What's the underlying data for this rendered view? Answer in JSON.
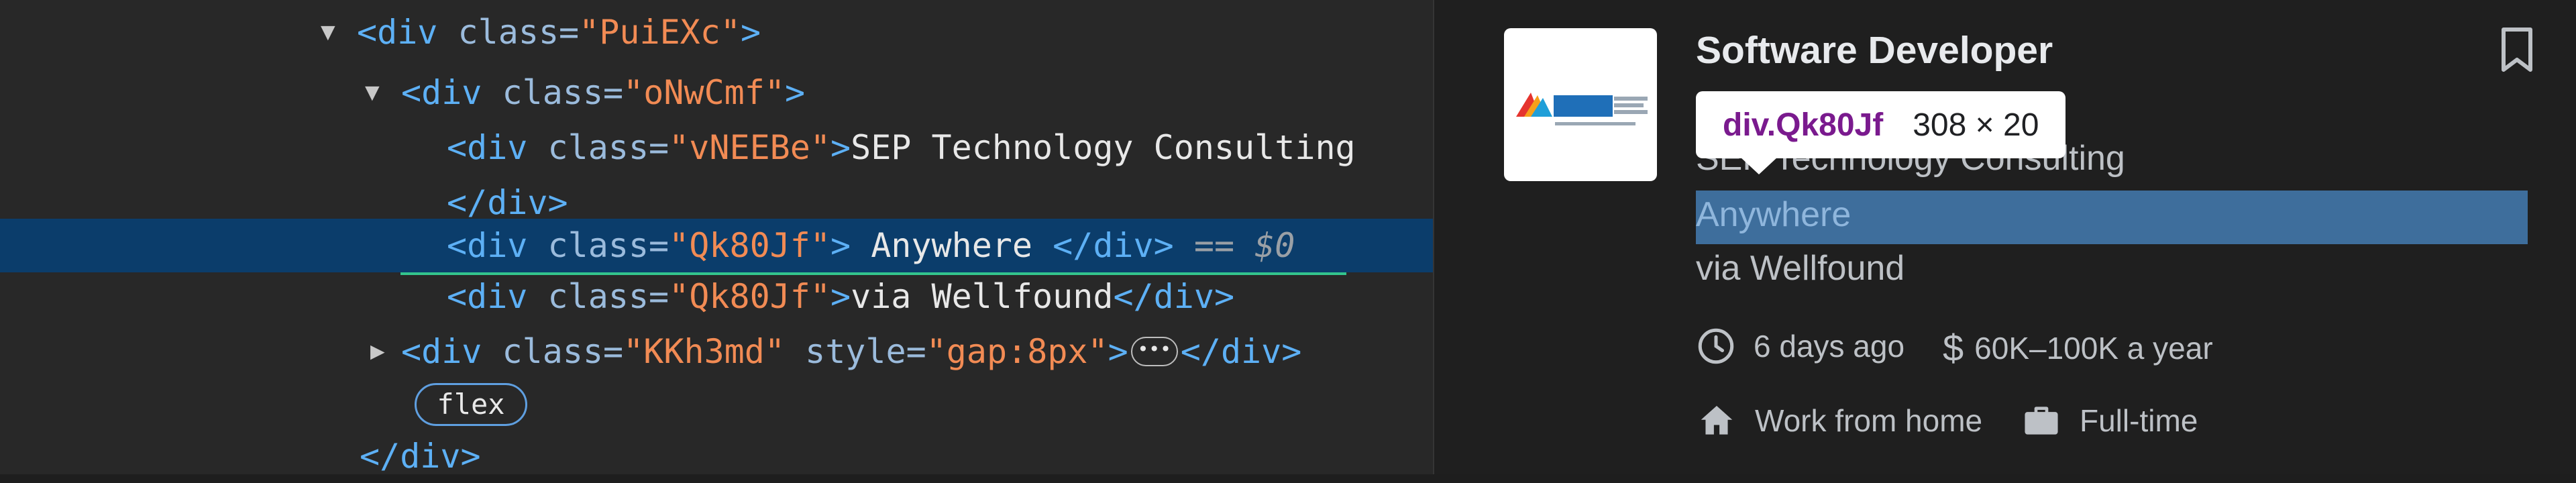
{
  "dom": {
    "line1": {
      "tag_open": "<div",
      "attr": "class=",
      "val": "\"PuiEXc\"",
      "tag_close": ">"
    },
    "line2": {
      "tag_open": "<div",
      "attr": "class=",
      "val": "\"oNwCmf\"",
      "tag_close": ">"
    },
    "line3": {
      "tag_open": "<div",
      "attr": "class=",
      "val": "\"vNEEBe\"",
      "tag_close": ">",
      "text": "SEP Technology Consulting"
    },
    "line4": {
      "close_tag": "</div>"
    },
    "line5": {
      "tag_open": "<div",
      "attr": "class=",
      "val": "\"Qk80Jf\"",
      "tag_close": ">",
      "text": " Anywhere ",
      "close_tag": "</div>",
      "marker": "==",
      "marker_var": "$0"
    },
    "line6": {
      "tag_open": "<div",
      "attr": "class=",
      "val": "\"Qk80Jf\"",
      "tag_close": ">",
      "text": "via Wellfound",
      "close_tag": "</div>"
    },
    "line7": {
      "tag_open": "<div",
      "attr": "class=",
      "val": "\"KKh3md\"",
      "attr2": " style=",
      "val2": "\"gap:8px\"",
      "tag_close": ">",
      "ellipsis": "•••",
      "close_tag": "</div>"
    },
    "flex_badge": "flex",
    "line9": {
      "close_tag": "</div>"
    }
  },
  "job": {
    "title": "Software Developer",
    "company": "SEP Technology Consulting",
    "location": "Anywhere",
    "via": "via Wellfound",
    "posted": "6 days ago",
    "salary": "60K–100K a year",
    "work_mode": "Work from home",
    "employment_type": "Full-time"
  },
  "tooltip": {
    "name": "div.Qk80Jf",
    "dims": "308 × 20"
  },
  "icons": {
    "clock": "clock-icon",
    "dollar": "dollar-icon",
    "home": "home-icon",
    "briefcase": "briefcase-icon",
    "bookmark": "bookmark-icon"
  },
  "colors": {
    "selected_row": "#0b3d6b",
    "highlight": "#3e6e9c",
    "tag": "#5db0f5",
    "attr_value": "#f28b54"
  }
}
